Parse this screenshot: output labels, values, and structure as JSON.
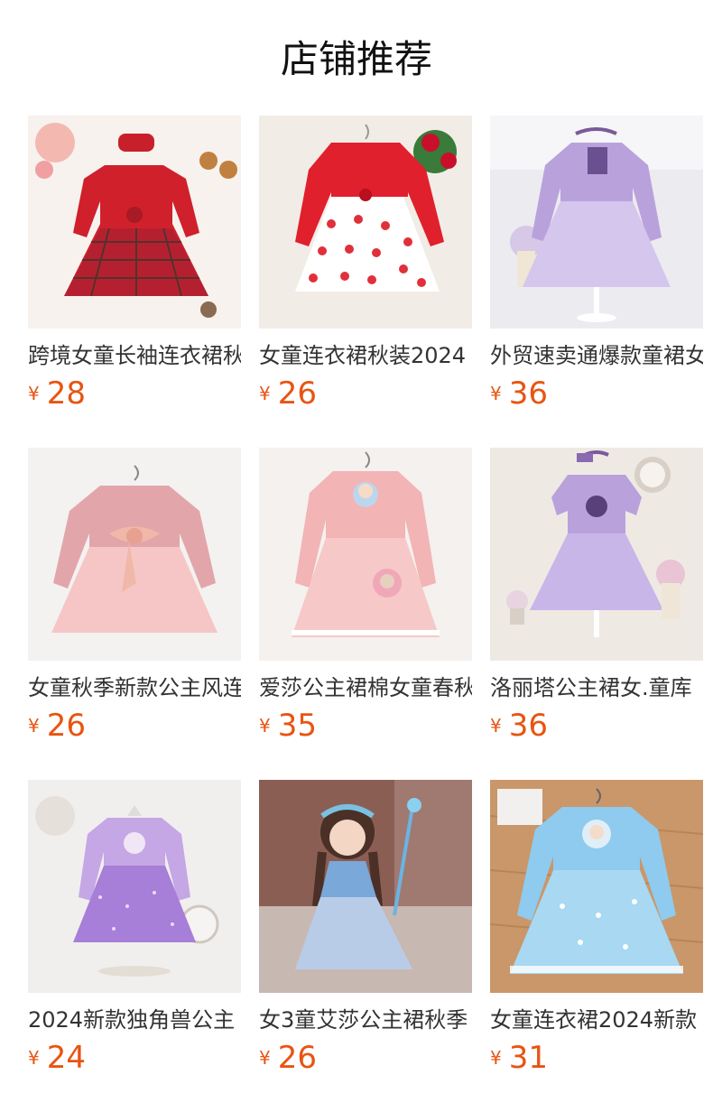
{
  "header": {
    "title": "店铺推荐"
  },
  "currency": "¥",
  "colors": {
    "price": "#e85412"
  },
  "products": [
    {
      "name": "跨境女童长袖连衣裙秋",
      "price": "28",
      "image": "red-plaid-dress-image"
    },
    {
      "name": "女童连衣裙秋装2024",
      "price": "26",
      "image": "red-heart-tulle-dress-image"
    },
    {
      "name": "外贸速卖通爆款童裙女",
      "price": "36",
      "image": "lavender-princess-dress-image"
    },
    {
      "name": "女童秋季新款公主风连",
      "price": "26",
      "image": "pink-bow-tutu-dress-image"
    },
    {
      "name": "爱莎公主裙棉女童春秋",
      "price": "35",
      "image": "pink-elsa-dress-image"
    },
    {
      "name": "洛丽塔公主裙女.童库",
      "price": "36",
      "image": "purple-lolita-dress-image"
    },
    {
      "name": "2024新款独角兽公主",
      "price": "24",
      "image": "purple-unicorn-dress-image"
    },
    {
      "name": "女3童艾莎公主裙秋季",
      "price": "26",
      "image": "blue-elsa-girl-photo-image"
    },
    {
      "name": "女童连衣裙2024新款",
      "price": "31",
      "image": "light-blue-frozen-dress-image"
    }
  ]
}
